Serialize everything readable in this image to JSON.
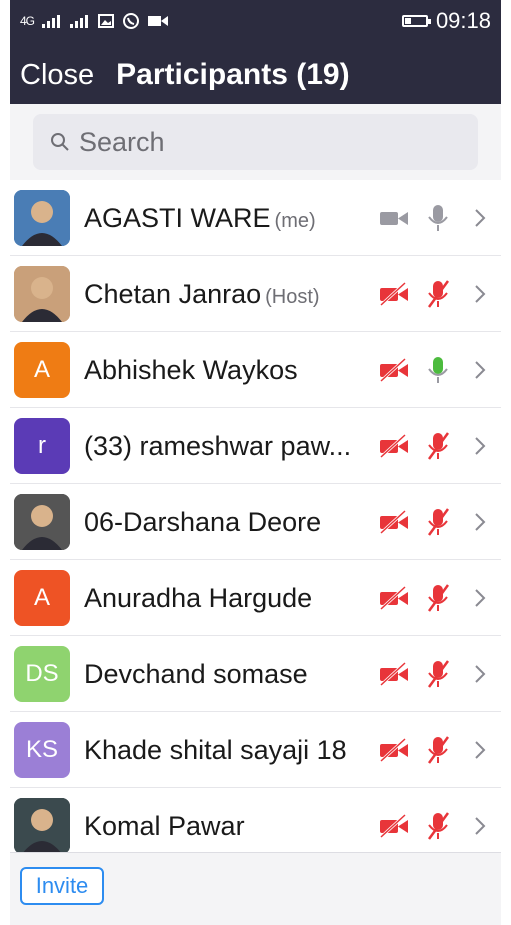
{
  "statusbar": {
    "network": "4G",
    "time": "09:18"
  },
  "header": {
    "close_label": "Close",
    "title": "Participants (19)"
  },
  "search": {
    "placeholder": "Search"
  },
  "participants": [
    {
      "name": "AGASTI WARE",
      "tag": "(me)",
      "avatar": "photo",
      "avatar_color": "#4a7db5",
      "video": "on",
      "audio": "on-muted-grey"
    },
    {
      "name": "Chetan Janrao",
      "tag": "(Host)",
      "avatar": "photo",
      "avatar_color": "#c9a07a",
      "video": "off",
      "audio": "muted"
    },
    {
      "name": "Abhishek Waykos",
      "tag": "",
      "avatar": "A",
      "avatar_color": "#ef7c14",
      "video": "off",
      "audio": "unmuted"
    },
    {
      "name": "(33) rameshwar paw...",
      "tag": "",
      "avatar": "r",
      "avatar_color": "#5b3bb6",
      "video": "off",
      "audio": "muted"
    },
    {
      "name": "06-Darshana Deore",
      "tag": "",
      "avatar": "photo",
      "avatar_color": "#555555",
      "video": "off",
      "audio": "muted"
    },
    {
      "name": "Anuradha Hargude",
      "tag": "",
      "avatar": "A",
      "avatar_color": "#ee5325",
      "video": "off",
      "audio": "muted"
    },
    {
      "name": "Devchand somase",
      "tag": "",
      "avatar": "DS",
      "avatar_color": "#8fd36f",
      "video": "off",
      "audio": "muted"
    },
    {
      "name": "Khade shital sayaji 18",
      "tag": "",
      "avatar": "KS",
      "avatar_color": "#9b7fd6",
      "video": "off",
      "audio": "muted"
    },
    {
      "name": "Komal Pawar",
      "tag": "",
      "avatar": "photo",
      "avatar_color": "#3b4a4e",
      "video": "off",
      "audio": "muted"
    }
  ],
  "footer": {
    "invite_label": "Invite"
  },
  "colors": {
    "header_bg": "#2c2c3f",
    "muted_red": "#e8353a",
    "mic_green": "#4cbb3e",
    "icon_grey": "#9a9aa2",
    "accent_blue": "#2d8cf0"
  }
}
